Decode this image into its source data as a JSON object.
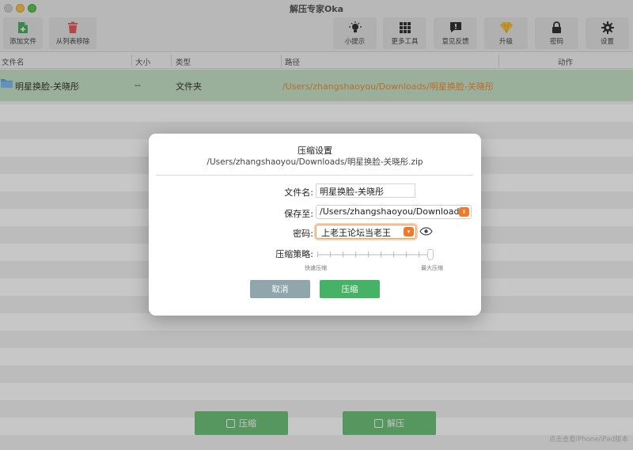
{
  "app": {
    "title": "解压专家Oka"
  },
  "toolbar": {
    "add_file": "添加文件",
    "remove_from_list": "从列表移除",
    "tips": "小提示",
    "more_tools": "更多工具",
    "feedback": "意见反馈",
    "upgrade": "升级",
    "password": "密码",
    "settings": "设置"
  },
  "table": {
    "headers": {
      "name": "文件名",
      "size": "大小",
      "type": "类型",
      "path": "路径",
      "action": "动作"
    },
    "rows": [
      {
        "name": "明星换脸-关晓彤",
        "size": "--",
        "type": "文件夹",
        "path": "/Users/zhangshaoyou/Downloads/明星换脸-关晓彤"
      }
    ]
  },
  "bottom": {
    "compress": "压缩",
    "extract": "解压",
    "ipad_note": "点击查看iPhone/iPad版本"
  },
  "dialog": {
    "title": "压缩设置",
    "path": "/Users/zhangshaoyou/Downloads/明星换脸-关晓彤.zip",
    "filename_label": "文件名:",
    "filename_value": "明星换脸-关晓彤",
    "save_to_label": "保存至:",
    "save_to_value": "/Users/zhangshaoyou/Downloads",
    "password_label": "密码:",
    "password_value": "上老王论坛当老王",
    "strategy_label": "压缩策略:",
    "strategy_min": "快速压缩",
    "strategy_max": "最大压缩",
    "strategy_level": 1.0,
    "cancel": "取消",
    "compress": "压缩"
  },
  "colors": {
    "accent_green": "#46b265",
    "accent_orange": "#ee7b2c",
    "selected_row": "#c7e2c6",
    "path_text": "#f08a3c"
  }
}
